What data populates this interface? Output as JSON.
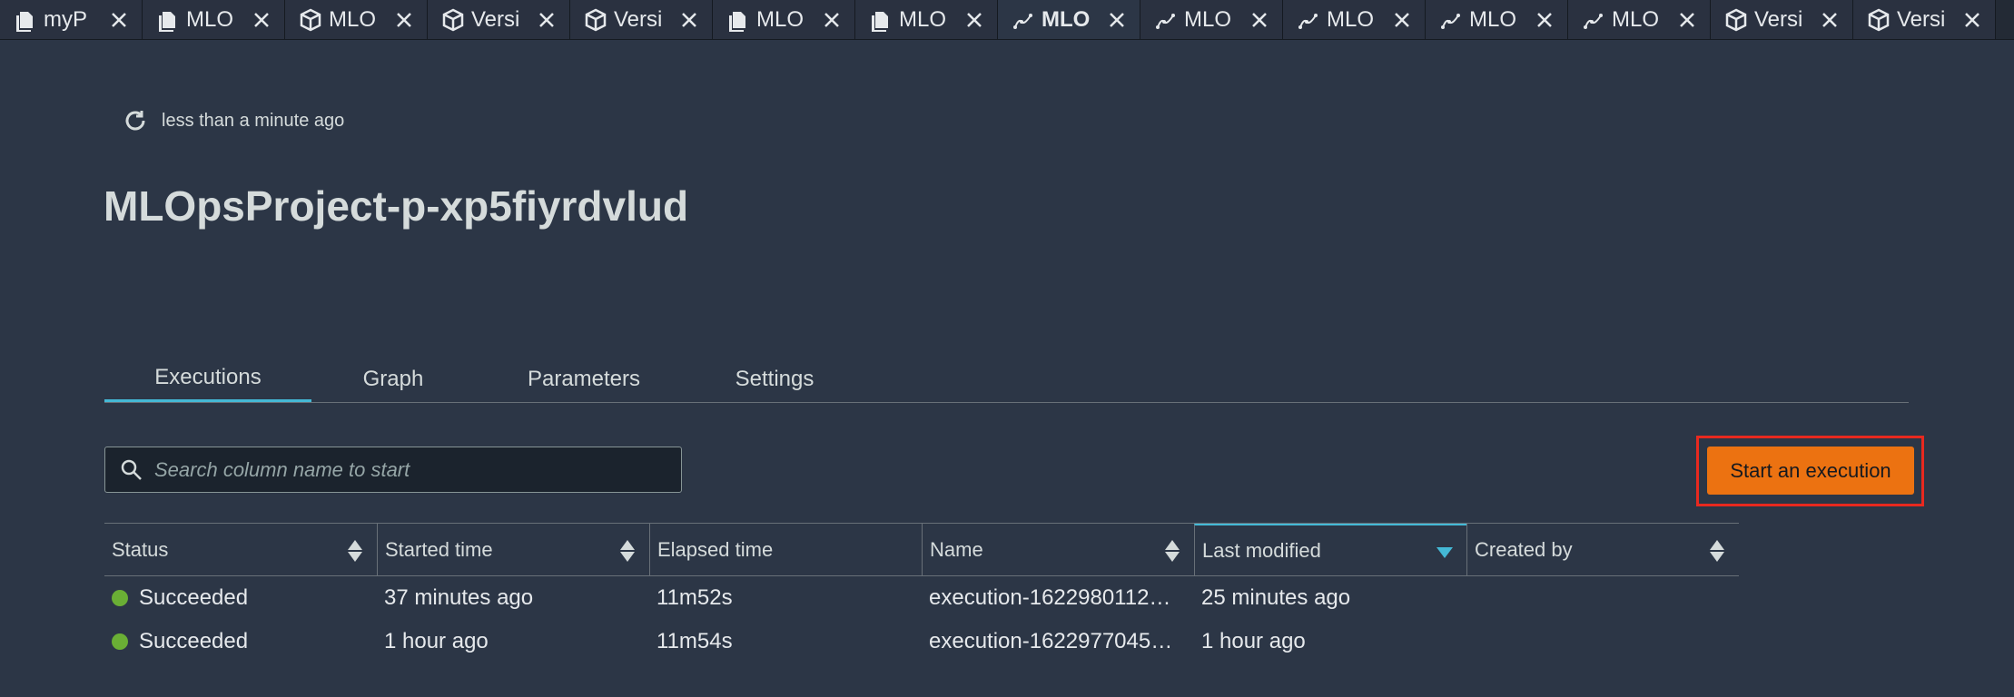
{
  "browser_tabs": [
    {
      "label": "myP",
      "icon": "document-icon",
      "active": false
    },
    {
      "label": "MLO",
      "icon": "document-icon",
      "active": false
    },
    {
      "label": "MLO",
      "icon": "package-icon",
      "active": false
    },
    {
      "label": "Versi",
      "icon": "package-icon",
      "active": false
    },
    {
      "label": "Versi",
      "icon": "package-icon",
      "active": false
    },
    {
      "label": "MLO",
      "icon": "document-icon",
      "active": false
    },
    {
      "label": "MLO",
      "icon": "document-icon",
      "active": false
    },
    {
      "label": "MLO",
      "icon": "pipeline-icon",
      "active": true
    },
    {
      "label": "MLO",
      "icon": "pipeline-icon",
      "active": false
    },
    {
      "label": "MLO",
      "icon": "pipeline-icon",
      "active": false
    },
    {
      "label": "MLO",
      "icon": "pipeline-icon",
      "active": false
    },
    {
      "label": "MLO",
      "icon": "pipeline-icon",
      "active": false
    },
    {
      "label": "Versi",
      "icon": "package-icon",
      "active": false
    },
    {
      "label": "Versi",
      "icon": "package-icon",
      "active": false
    }
  ],
  "refresh": {
    "text": "less than a minute ago"
  },
  "page": {
    "title": "MLOpsProject-p-xp5fiyrdvlud"
  },
  "page_tabs": [
    {
      "label": "Executions",
      "active": true
    },
    {
      "label": "Graph",
      "active": false
    },
    {
      "label": "Parameters",
      "active": false
    },
    {
      "label": "Settings",
      "active": false
    }
  ],
  "search": {
    "placeholder": "Search column name to start",
    "value": ""
  },
  "start_button": {
    "label": "Start an execution",
    "highlight_color": "#e8291f"
  },
  "table": {
    "columns": [
      "Status",
      "Started time",
      "Elapsed time",
      "Name",
      "Last modified",
      "Created by"
    ],
    "sorted_column": "Last modified",
    "sort_direction": "descending",
    "rows": [
      {
        "status": "Succeeded",
        "started": "37 minutes ago",
        "elapsed": "11m52s",
        "name": "execution-1622980112…",
        "modified": "25 minutes ago",
        "created_by": ""
      },
      {
        "status": "Succeeded",
        "started": "1 hour ago",
        "elapsed": "11m54s",
        "name": "execution-1622977045…",
        "modified": "1 hour ago",
        "created_by": ""
      }
    ]
  },
  "colors": {
    "accent": "#44b9d6",
    "primary_button": "#ec7211",
    "success": "#6aaf35",
    "background": "#2c3646"
  }
}
